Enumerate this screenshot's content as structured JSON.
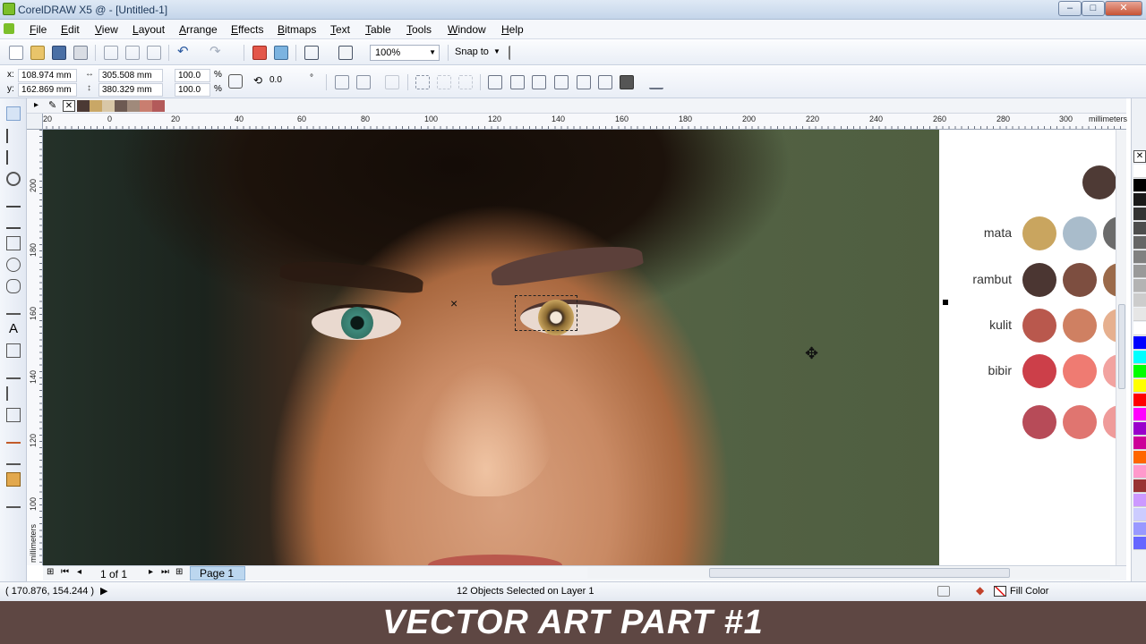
{
  "window": {
    "title": "CorelDRAW X5 @ - [Untitled-1]",
    "min": "–",
    "max": "□",
    "close": "✕"
  },
  "menu": [
    "File",
    "Edit",
    "View",
    "Layout",
    "Arrange",
    "Effects",
    "Bitmaps",
    "Text",
    "Table",
    "Tools",
    "Window",
    "Help"
  ],
  "standard_toolbar": {
    "zoom": "100%",
    "snap_label": "Snap to"
  },
  "property_bar": {
    "x_label": "x:",
    "x": "108.974 mm",
    "y_label": "y:",
    "y": "162.869 mm",
    "w": "305.508 mm",
    "h": "380.329 mm",
    "scale_w": "100.0",
    "scale_h": "100.0",
    "pct": "%",
    "rotation": "0.0",
    "deg": "°"
  },
  "ruler": {
    "h_ticks": [
      "20",
      "0",
      "20",
      "40",
      "60",
      "80",
      "100",
      "120",
      "140",
      "160",
      "180",
      "200",
      "220",
      "240",
      "260",
      "280",
      "300"
    ],
    "units": "millimeters",
    "v_ticks": [
      "200",
      "180",
      "160",
      "140",
      "120",
      "100"
    ],
    "v_units": "millimeters"
  },
  "doc_palette": [
    "#4b3934",
    "#c9a766",
    "#d8c7a7",
    "#6d5a52",
    "#a08a7b",
    "#c97e70",
    "#b35a5a"
  ],
  "reference": {
    "rows": [
      {
        "label": "mata",
        "colors": [
          "#c9a55f",
          "#a9bccb",
          "#6b6b6b"
        ]
      },
      {
        "label": "rambut",
        "colors": [
          "#4b3632",
          "#7d4e40",
          "#9b6a4a"
        ]
      },
      {
        "label": "kulit",
        "colors": [
          "#b9584d",
          "#cf8062",
          "#e6b08f"
        ]
      },
      {
        "label": "bibir",
        "colors": [
          "#cc3f49",
          "#ef7b72",
          "#f2a3a0"
        ]
      },
      {
        "label": "",
        "colors": [
          "#b74b58",
          "#e07570",
          "#ef9b9a"
        ]
      }
    ],
    "top_color": "#4e3a35"
  },
  "color_palette": [
    "#ffffff",
    "#000000",
    "#1a1a1a",
    "#333333",
    "#4d4d4d",
    "#666666",
    "#808080",
    "#999999",
    "#b3b3b3",
    "#cccccc",
    "#e6e6e6",
    "#ffffff",
    "#0000ff",
    "#00ffff",
    "#00ff00",
    "#ffff00",
    "#ff0000",
    "#ff00ff",
    "#9900cc",
    "#cc0099",
    "#ff6600",
    "#ff99cc",
    "#993333",
    "#cc99ff",
    "#ccccff",
    "#9999ff",
    "#6666ff"
  ],
  "pagebar": {
    "page_count": "1 of 1",
    "page_tab": "Page 1"
  },
  "status": {
    "coords": "( 170.876, 154.244 )",
    "selection": "12 Objects Selected on Layer 1",
    "fill": "Fill Color"
  },
  "banner": {
    "text": "VECTOR ART PART #1"
  }
}
